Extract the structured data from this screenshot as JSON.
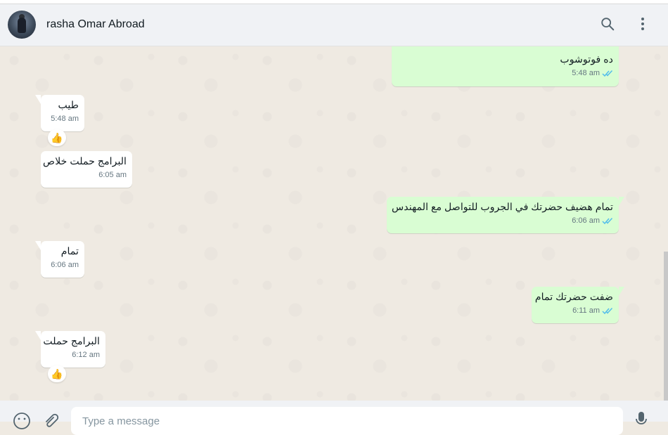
{
  "contact": {
    "name": "rasha Omar Abroad"
  },
  "icons": {
    "search": "search-icon",
    "menu": "kebab-menu-icon",
    "emoji": "emoji-icon",
    "attach": "paperclip-icon",
    "mic": "microphone-icon",
    "read": "double-check-icon"
  },
  "colors": {
    "incoming_bubble": "#ffffff",
    "outgoing_bubble": "#d9fdd3",
    "read_tick": "#53bdeb",
    "chat_bg": "#efeae2",
    "header_bg": "#f0f2f5"
  },
  "messages": [
    {
      "direction": "outgoing",
      "text": "ده فوتوشوب",
      "time": "5:48 am",
      "status": "read"
    },
    {
      "direction": "incoming",
      "text": "طيب",
      "time": "5:48 am",
      "reaction": "👍"
    },
    {
      "direction": "incoming",
      "text": "البرامج حملت خلاص",
      "time": "6:05 am"
    },
    {
      "direction": "outgoing",
      "text": "تمام هضيف حضرتك في الجروب للتواصل مع المهندس",
      "time": "6:06 am",
      "status": "read"
    },
    {
      "direction": "incoming",
      "text": "تمام",
      "time": "6:06 am"
    },
    {
      "direction": "outgoing",
      "text": "ضفت حضرتك تمام",
      "time": "6:11 am",
      "status": "read"
    },
    {
      "direction": "incoming",
      "text": "البرامج حملت",
      "time": "6:12 am",
      "reaction": "👍"
    }
  ],
  "composer": {
    "placeholder": "Type a message"
  }
}
